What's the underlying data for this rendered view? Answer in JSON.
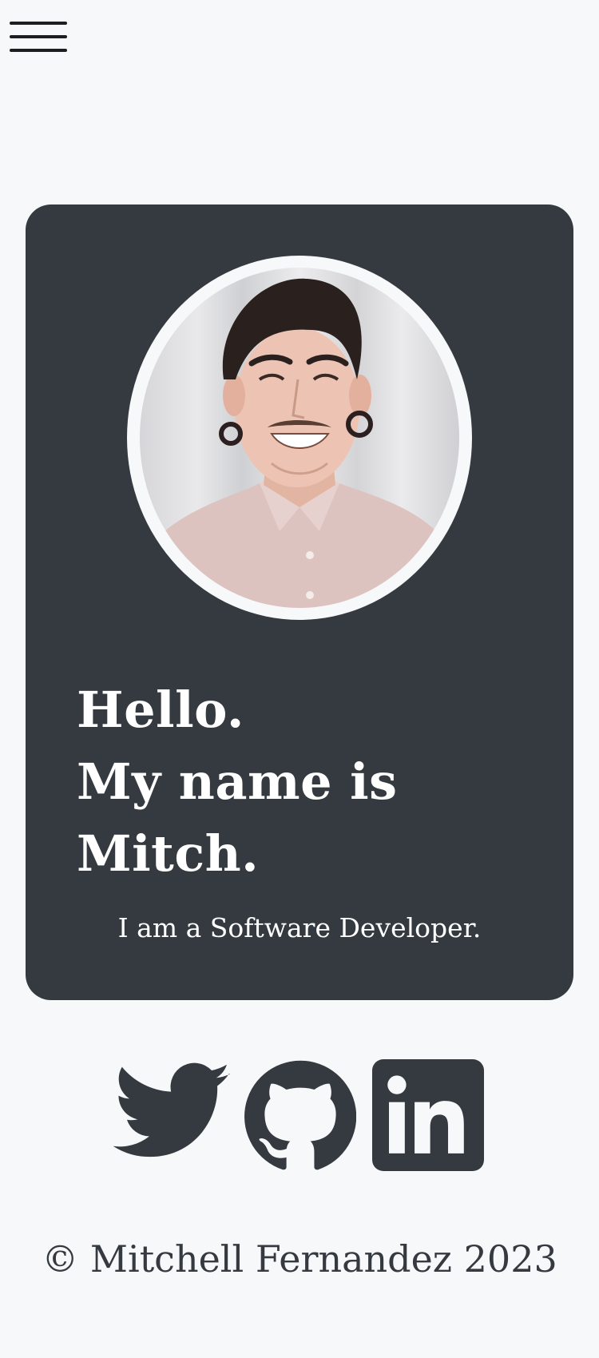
{
  "nav": {
    "menu_icon": "hamburger-menu-icon"
  },
  "hero": {
    "avatar": "profile-photo",
    "greeting_lines": [
      "Hello.",
      "My name is",
      "Mitch."
    ],
    "tagline": "I am a Software Developer."
  },
  "social": {
    "icons": [
      "twitter-icon",
      "github-icon",
      "linkedin-icon"
    ]
  },
  "footer": {
    "copyright": "© Mitchell Fernandez 2023"
  },
  "colors": {
    "page_background": "#f7f8fa",
    "card_background": "#343a40",
    "card_text": "#ffffff",
    "icon_color": "#343a40"
  }
}
